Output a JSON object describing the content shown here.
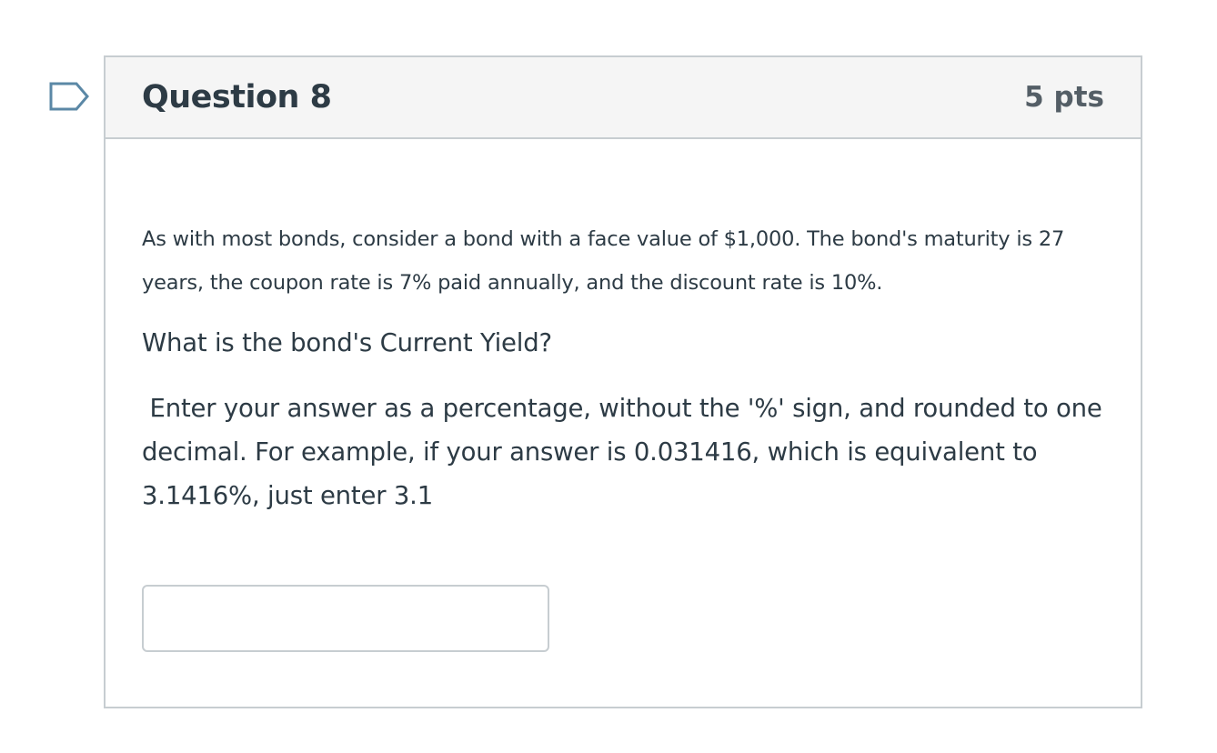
{
  "question": {
    "title": "Question 8",
    "points": "5 pts",
    "paragraph1": "As with most bonds, consider a bond with a face value of $1,000. The bond's maturity is 27 years, the coupon rate is 7% paid annually, and the discount rate is 10%.",
    "paragraph2": "What is the bond's Current Yield?",
    "paragraph3": " Enter your answer as a percentage, without the '%' sign, and rounded to one decimal. For example, if your answer is 0.031416, which is equivalent to 3.1416%, just enter 3.1",
    "answer_value": ""
  },
  "icons": {
    "flag": "bookmark-flag-icon"
  },
  "colors": {
    "border": "#c7cdd1",
    "header_bg": "#f5f5f5",
    "text": "#2d3b45",
    "flag_stroke": "#5b88a6"
  }
}
